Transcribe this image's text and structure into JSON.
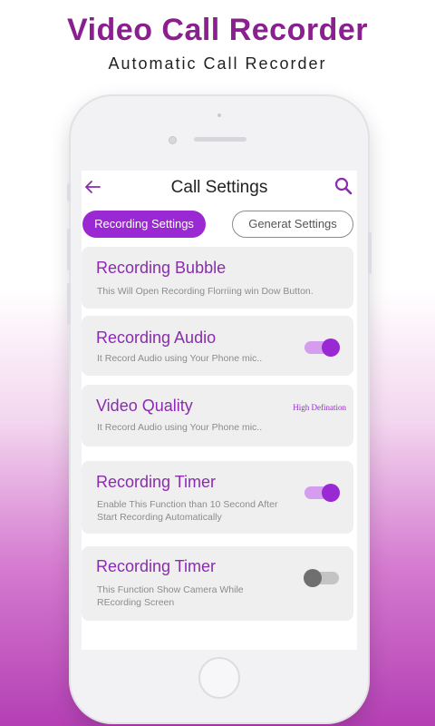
{
  "promo": {
    "title": "Video Call Recorder",
    "subtitle": "Automatic Call Recorder"
  },
  "appbar": {
    "title": "Call Settings",
    "back_icon": "arrow-left-icon",
    "search_icon": "search-icon"
  },
  "tabs": [
    {
      "label": "Recording Settings",
      "active": true
    },
    {
      "label": "Generat Settings",
      "active": false
    }
  ],
  "settings": [
    {
      "title": "Recording Bubble",
      "desc": "This Will Open Recording Florriing win Dow Button."
    },
    {
      "title": "Recording Audio",
      "desc": "It Record Audio using Your Phone mic..",
      "toggle": true
    },
    {
      "title": "Video Quality",
      "desc": "It Record Audio using Your Phone mic..",
      "value": "High Defination"
    },
    {
      "title": "Recording Timer",
      "desc_line1": "Enable This Function than 10 Second After",
      "desc_line2": "Start Recording Automatically",
      "toggle": true
    },
    {
      "title": "Recording Timer",
      "desc_line1": "This Function Show Camera While",
      "desc_line2": "REcording Screen",
      "toggle": false
    }
  ],
  "colors": {
    "accent": "#9a29d4",
    "title_purple": "#8a1f8f",
    "card_bg": "#efefef"
  }
}
